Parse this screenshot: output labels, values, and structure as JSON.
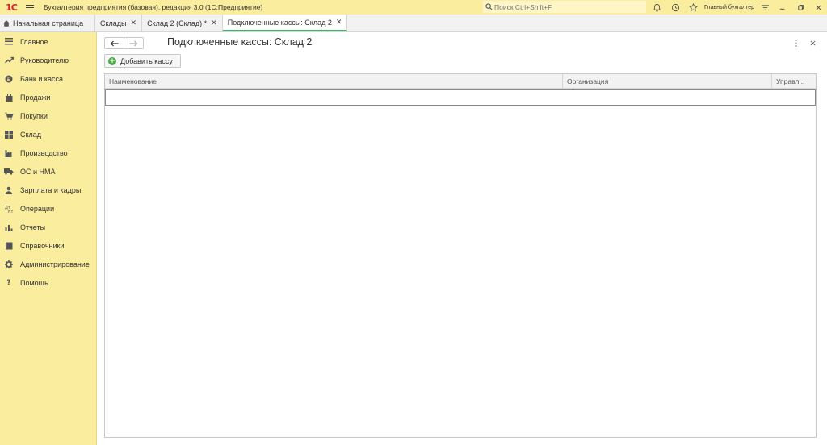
{
  "titlebar": {
    "logo": "1С",
    "app_title": "Бухгалтерия предприятия (базовая), редакция 3.0  (1С:Предприятие)",
    "search_placeholder": "Поиск Ctrl+Shift+F",
    "user": "Главный бухгалтер",
    "icons": [
      "bell-icon",
      "history-icon",
      "star-icon",
      "settings-lines-icon",
      "minimize-icon",
      "restore-icon",
      "close-icon"
    ]
  },
  "tabs": [
    {
      "label": "Начальная страница",
      "closable": false,
      "active": false
    },
    {
      "label": "Склады",
      "closable": true,
      "active": false
    },
    {
      "label": "Склад 2 (Склад) *",
      "closable": true,
      "active": false
    },
    {
      "label": "Подключенные кассы: Склад 2",
      "closable": true,
      "active": true
    }
  ],
  "sidebar": {
    "items": [
      {
        "label": "Главное",
        "icon": "menu-lines-icon"
      },
      {
        "label": "Руководителю",
        "icon": "trend-icon"
      },
      {
        "label": "Банк и касса",
        "icon": "coin-icon"
      },
      {
        "label": "Продажи",
        "icon": "bag-icon"
      },
      {
        "label": "Покупки",
        "icon": "cart-icon"
      },
      {
        "label": "Склад",
        "icon": "warehouse-icon"
      },
      {
        "label": "Производство",
        "icon": "factory-icon"
      },
      {
        "label": "ОС и НМА",
        "icon": "truck-icon"
      },
      {
        "label": "Зарплата и кадры",
        "icon": "person-icon"
      },
      {
        "label": "Операции",
        "icon": "dt-kt-icon"
      },
      {
        "label": "Отчеты",
        "icon": "bar-chart-icon"
      },
      {
        "label": "Справочники",
        "icon": "book-icon"
      },
      {
        "label": "Администрирование",
        "icon": "gear-icon"
      },
      {
        "label": "Помощь",
        "icon": "question-icon"
      }
    ]
  },
  "main": {
    "title": "Подключенные кассы: Склад 2",
    "add_button": "Добавить кассу",
    "columns": [
      "Наименование",
      "Организация",
      "Управл..."
    ]
  }
}
